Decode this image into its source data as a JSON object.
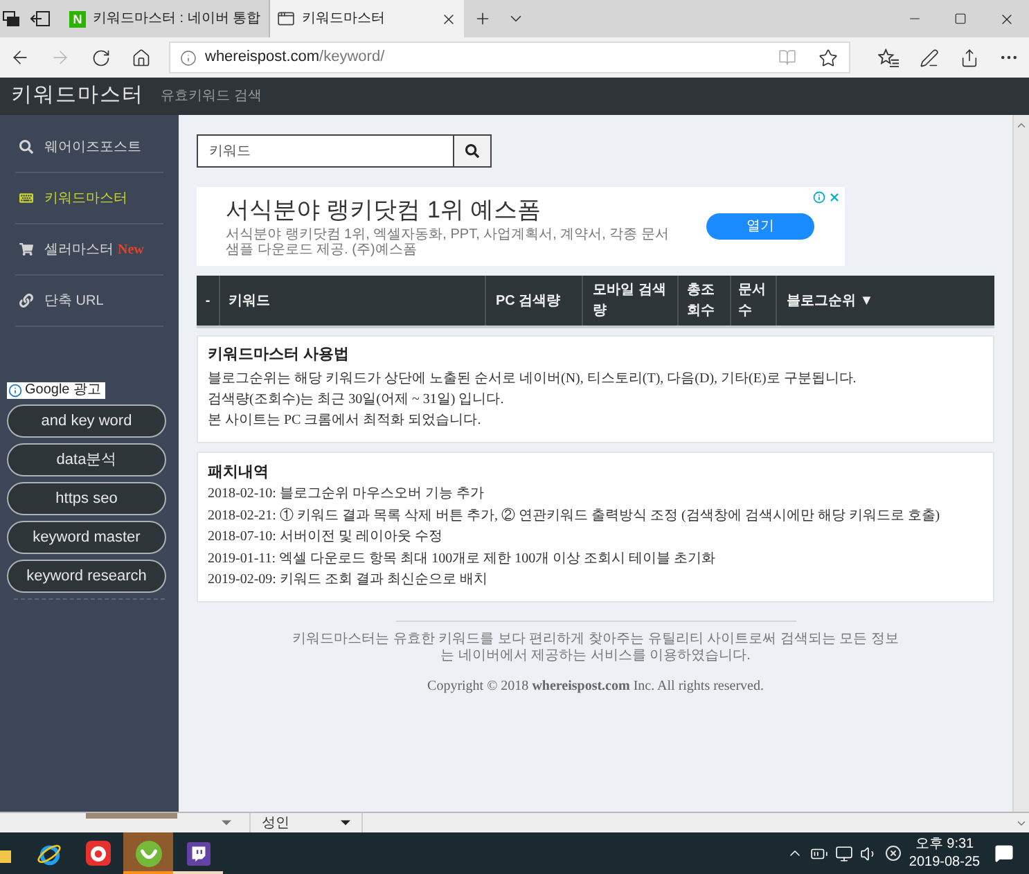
{
  "browser": {
    "tabs": [
      {
        "favicon_text": "N",
        "title": "키워드마스터 : 네이버 통합",
        "selected": false
      },
      {
        "title": "키워드마스터",
        "selected": true
      }
    ],
    "navigation": {
      "back_disabled": false,
      "forward_disabled": true
    },
    "address": {
      "host": "whereispost.com",
      "path": "/keyword/"
    }
  },
  "site_header": {
    "title": "키워드마스터",
    "subtitle": "유효키워드 검색"
  },
  "sidebar": {
    "items": [
      {
        "label": "웨어이즈포스트",
        "selected": false
      },
      {
        "label": "키워드마스터",
        "selected": true
      },
      {
        "label": "셀러마스터",
        "badge": "New",
        "selected": false
      },
      {
        "label": "단축 URL",
        "selected": false
      }
    ],
    "ad_label": "Google 광고",
    "ad_links": [
      "and key word",
      "data분석",
      "https seo",
      "keyword master",
      "keyword research"
    ]
  },
  "search": {
    "placeholder": "키워드"
  },
  "ad": {
    "title": "서식분야 랭키닷컴 1위 예스폼",
    "description": "서식분야 랭키닷컴 1위, 엑셀자동화, PPT, 사업계획서, 계약서, 각종 문서샘플 다운로드 제공. (주)예스폼",
    "button": "열기"
  },
  "table": {
    "columns": [
      "-",
      "키워드",
      "PC 검색량",
      "모바일 검색량",
      "총조회수",
      "문서수",
      "블로그순위 ▼"
    ]
  },
  "notices": [
    {
      "title": "키워드마스터 사용법",
      "lines": [
        "블로그순위는 해당 키워드가 상단에 노출된 순서로 네이버(N), 티스토리(T), 다음(D), 기타(E)로 구분됩니다.",
        "검색량(조회수)는 최근 30일(어제 ~ 31일) 입니다.",
        "본 사이트는 PC 크롬에서 최적화 되었습니다."
      ]
    },
    {
      "title": "패치내역",
      "lines": [
        "2018-02-10: 블로그순위 마우스오버 기능 추가",
        "2018-02-21: ① 키워드 결과 목록 삭제 버튼 추가, ② 연관키워드 출력방식 조정 (검색창에 검색시에만 해당 키워드로 호출)",
        "2018-07-10: 서버이전 및 레이아웃 수정",
        "2019-01-11: 엑셀 다운로드 항목 최대 100개로 제한 100개 이상 조회시 테이블 초기화",
        "2019-02-09: 키워드 조회 결과 최신순으로 배치"
      ]
    }
  ],
  "footer": {
    "text": "키워드마스터는 유효한 키워드를 보다 편리하게 찾아주는 유틸리티 사이트로써 검색되는 모든 정보는 네이버에서 제공하는 서비스를 이용하였습니다.",
    "copyright": "Copyright © 2018 **whereispost.com** Inc. All rights reserved."
  },
  "lower_strip": {
    "dropdown": "성인"
  },
  "taskbar": {
    "apps": [
      {
        "selected": false,
        "running": false
      },
      {
        "selected": false,
        "running": false
      },
      {
        "selected": false,
        "running": false
      },
      {
        "selected": true,
        "running": true
      },
      {
        "selected": false,
        "running": true
      }
    ],
    "clock": {
      "time": "오후 9:31",
      "date": "2019-08-25"
    }
  }
}
